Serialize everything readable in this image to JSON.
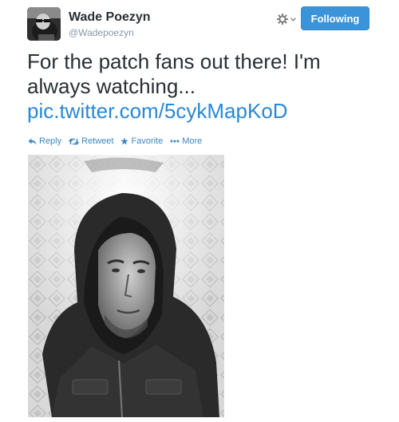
{
  "user": {
    "name": "Wade Poezyn",
    "handle": "@Wadepoezyn"
  },
  "header": {
    "follow_label": "Following",
    "gear_icon": "gear-icon",
    "chevron_icon": "chevron-down-icon"
  },
  "tweet": {
    "line1": "For the patch fans out there! I'm",
    "line2": "always watching...",
    "link": "pic.twitter.com/5cykMapKoD"
  },
  "actions": {
    "reply": "Reply",
    "retweet": "Retweet",
    "favorite": "Favorite",
    "more": "More"
  },
  "colors": {
    "accent": "#3b94d9",
    "link": "#2a88d4",
    "action": "#3b88c3",
    "text": "#292f33",
    "muted": "#8899a6"
  }
}
